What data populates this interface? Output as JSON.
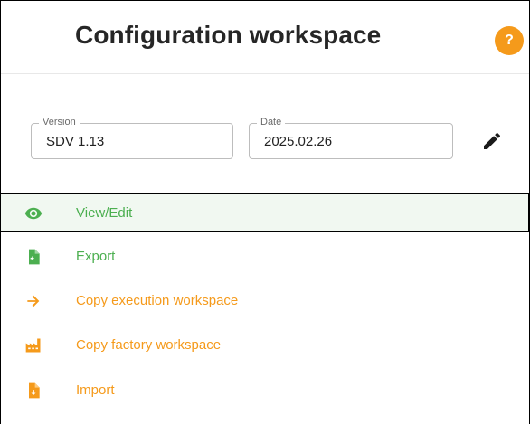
{
  "header": {
    "title": "Configuration workspace",
    "help_label": "?"
  },
  "fields": {
    "version": {
      "label": "Version",
      "value": "SDV 1.13"
    },
    "date": {
      "label": "Date",
      "value": "2025.02.26"
    }
  },
  "menu": {
    "items": [
      {
        "label": "View/Edit",
        "icon": "eye-icon",
        "color": "#4caf50",
        "selected": true
      },
      {
        "label": "Export",
        "icon": "file-export-icon",
        "color": "#4caf50",
        "selected": false
      },
      {
        "label": "Copy execution workspace",
        "icon": "arrow-right-icon",
        "color": "#f59a1b",
        "selected": false
      },
      {
        "label": "Copy factory workspace",
        "icon": "factory-icon",
        "color": "#f59a1b",
        "selected": false
      },
      {
        "label": "Import",
        "icon": "file-import-icon",
        "color": "#f59a1b",
        "selected": false
      }
    ]
  },
  "colors": {
    "green_accent": "#4caf50",
    "orange_accent": "#f59a1b",
    "selected_background": "#f1f8f1"
  }
}
